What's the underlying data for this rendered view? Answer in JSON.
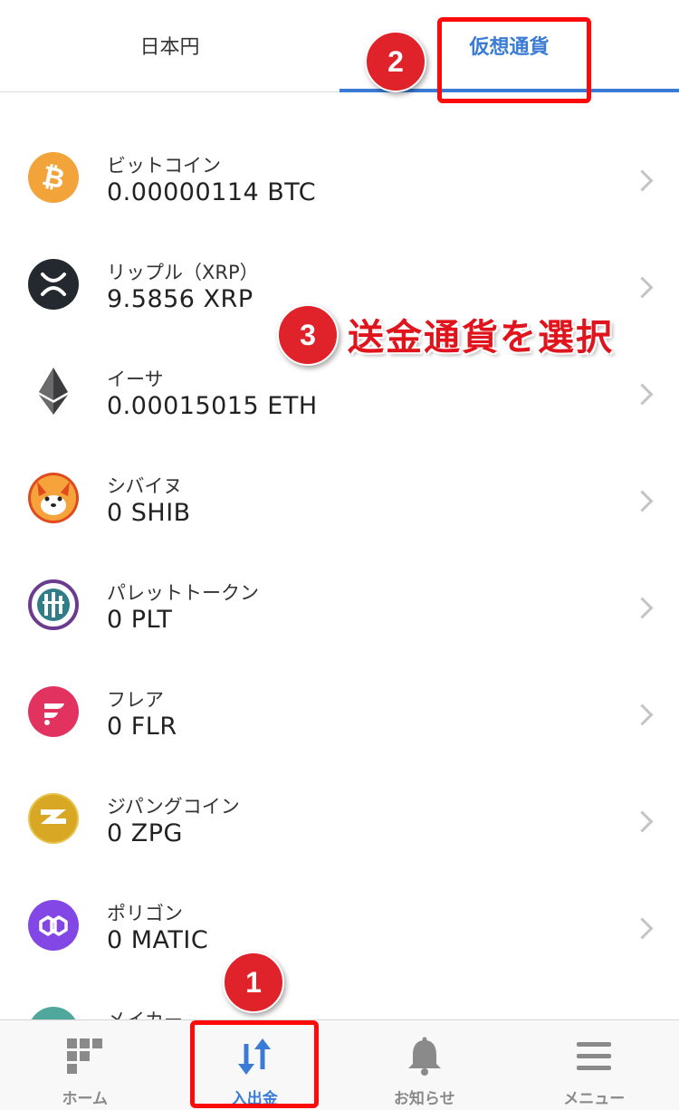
{
  "tabs": [
    {
      "label": "日本円",
      "active": false
    },
    {
      "label": "仮想通貨",
      "active": true
    }
  ],
  "coins": [
    {
      "name": "ビットコイン",
      "amount": "0.00000114 BTC",
      "icon": "bitcoin-icon",
      "color": "#f2a33a"
    },
    {
      "name": "リップル（XRP）",
      "amount": "9.5856 XRP",
      "icon": "xrp-icon",
      "color": "#23292f"
    },
    {
      "name": "イーサ",
      "amount": "0.00015015 ETH",
      "icon": "ethereum-icon",
      "color": "#3c3c3d"
    },
    {
      "name": "シバイヌ",
      "amount": "0 SHIB",
      "icon": "shiba-inu-icon",
      "color": "#e04a1f"
    },
    {
      "name": "パレットトークン",
      "amount": "0 PLT",
      "icon": "palette-token-icon",
      "color": "#2f7d87"
    },
    {
      "name": "フレア",
      "amount": "0 FLR",
      "icon": "flare-icon",
      "color": "#e2325f"
    },
    {
      "name": "ジパングコイン",
      "amount": "0 ZPG",
      "icon": "zipang-coin-icon",
      "color": "#d8a824"
    },
    {
      "name": "ポリゴン",
      "amount": "0 MATIC",
      "icon": "polygon-icon",
      "color": "#8247e5"
    },
    {
      "name": "メイカー",
      "amount": "",
      "icon": "maker-icon",
      "color": "#4fa89b"
    }
  ],
  "bottom_nav": [
    {
      "label": "ホーム",
      "icon": "home-icon",
      "active": false
    },
    {
      "label": "入出金",
      "icon": "transfer-arrows-icon",
      "active": true
    },
    {
      "label": "お知らせ",
      "icon": "bell-icon",
      "active": false
    },
    {
      "label": "メニュー",
      "icon": "menu-icon",
      "active": false
    }
  ],
  "annotations": {
    "step1": "1",
    "step2": "2",
    "step3": "3",
    "callout": "送金通貨を選択"
  },
  "colors": {
    "accent": "#3a7bd5",
    "annotation_red": "#e0222a"
  }
}
